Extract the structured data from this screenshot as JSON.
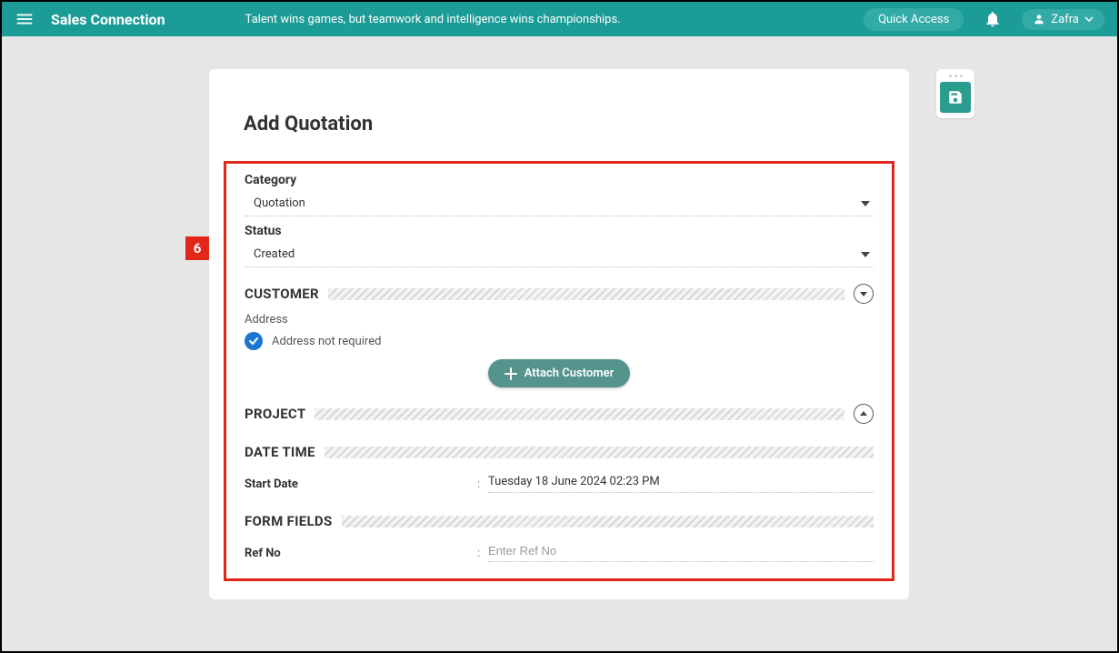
{
  "header": {
    "brand": "Sales Connection",
    "tagline": "Talent wins games, but teamwork and intelligence wins championships.",
    "quick_access_label": "Quick Access",
    "user_name": "Zafra"
  },
  "page": {
    "title": "Add Quotation",
    "step_badge": "6"
  },
  "form": {
    "category": {
      "label": "Category",
      "value": "Quotation"
    },
    "status": {
      "label": "Status",
      "value": "Created"
    },
    "customer": {
      "title": "CUSTOMER",
      "address_label": "Address",
      "address_value": "Address not required",
      "attach_btn": "Attach Customer"
    },
    "project": {
      "title": "PROJECT"
    },
    "datetime": {
      "title": "DATE TIME",
      "start_label": "Start Date",
      "start_value": "Tuesday 18 June 2024 02:23 PM"
    },
    "formfields": {
      "title": "FORM FIELDS",
      "ref_label": "Ref No",
      "ref_placeholder": "Enter Ref No"
    }
  }
}
